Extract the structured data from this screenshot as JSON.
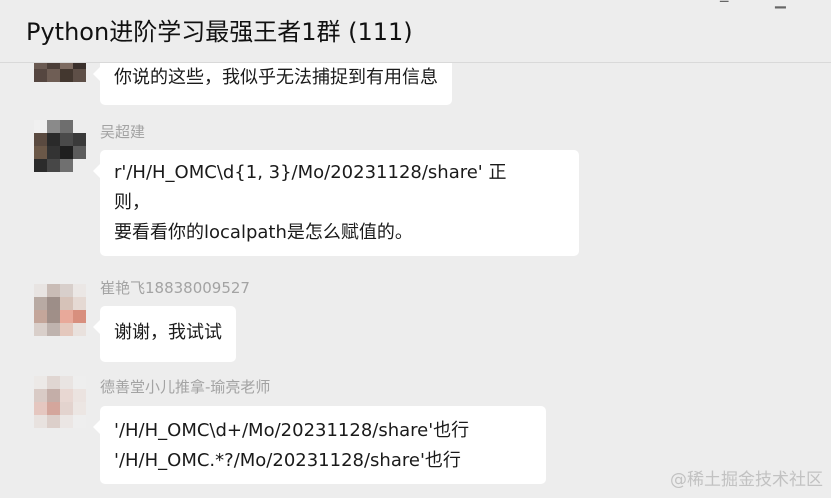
{
  "window": {
    "title": "Python进阶学习最强王者1群 (111)"
  },
  "messages": [
    {
      "sender": "",
      "lines": [
        "你说的这些，我似乎无法捕捉到有用信息"
      ]
    },
    {
      "sender": "吴超建",
      "lines": [
        "r'/H/H_OMC\\d{1, 3}/Mo/20231128/share'  正",
        "则，",
        "要看看你的localpath是怎么赋值的。"
      ]
    },
    {
      "sender": "崔艳飞18838009527",
      "lines": [
        "谢谢，我试试"
      ]
    },
    {
      "sender": "德善堂小儿推拿-瑜亮老师",
      "lines": [
        "'/H/H_OMC\\d+/Mo/20231128/share'也行",
        "'/H/H_OMC.*?/Mo/20231128/share'也行"
      ]
    }
  ],
  "watermark": "@稀土掘金技术社区",
  "colors": {
    "background": "#ededed",
    "bubble": "#ffffff",
    "sender_name": "#a3a3a3"
  }
}
